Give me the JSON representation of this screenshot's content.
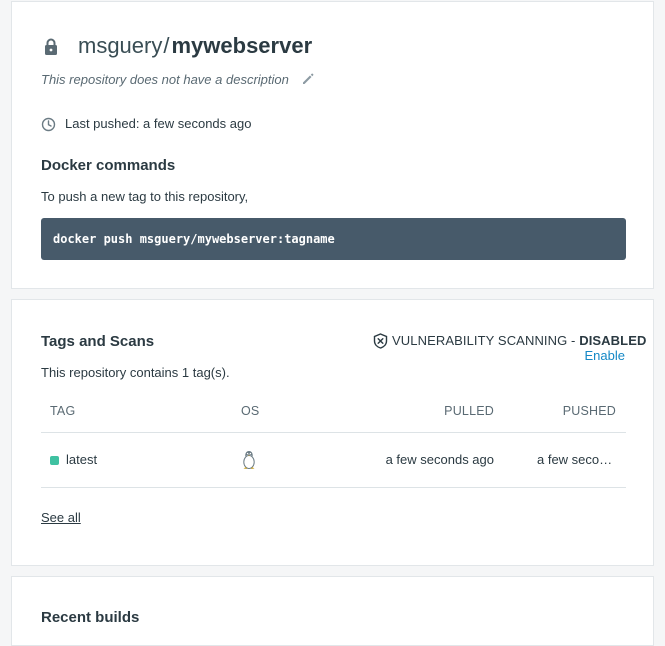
{
  "repo": {
    "namespace": "msguery",
    "separator": "/",
    "name": "mywebserver",
    "description": "This repository does not have a description",
    "last_pushed": "Last pushed: a few seconds ago",
    "icons": {
      "lock": "lock-icon",
      "edit": "pencil-icon",
      "time": "clock-icon"
    }
  },
  "docker_commands": {
    "heading": "Docker commands",
    "hint": "To push a new tag to this repository,",
    "command": "docker push msguery/mywebserver:tagname"
  },
  "tags_scans": {
    "heading": "Tags and Scans",
    "vuln_label": "VULNERABILITY SCANNING - ",
    "vuln_status": "DISABLED",
    "enable_label": "Enable",
    "count_text": "This repository contains 1 tag(s).",
    "columns": {
      "tag": "TAG",
      "os": "OS",
      "pulled": "PULLED",
      "pushed": "PUSHED"
    },
    "rows": [
      {
        "tag": "latest",
        "os_icon": "linux-icon",
        "pulled": "a few seconds ago",
        "pushed": "a few seconds ago",
        "status_color": "#3fc1a1"
      }
    ],
    "see_all": "See all"
  },
  "recent_builds": {
    "heading": "Recent builds"
  },
  "colors": {
    "command_bg": "#475a6a",
    "link": "#1488c6",
    "status": "#3fc1a1"
  }
}
